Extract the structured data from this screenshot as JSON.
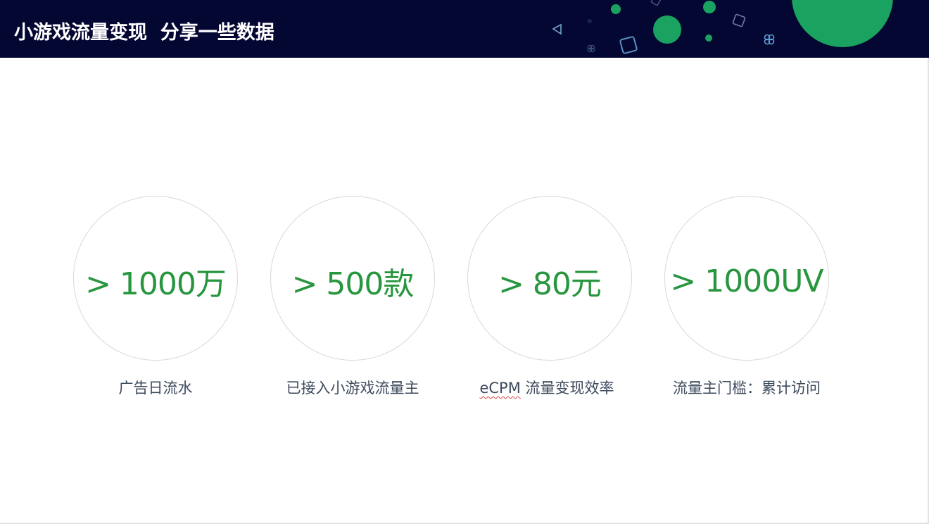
{
  "header": {
    "title": "小游戏流量变现  分享一些数据"
  },
  "stats": [
    {
      "value": "> 1000万",
      "label": "广告日流水"
    },
    {
      "value": "> 500款",
      "label": "已接入小游戏流量主"
    },
    {
      "value": "> 80元",
      "label_prefix": "eCPM",
      "label_suffix": " 流量变现效率"
    },
    {
      "value": "> 1000UV",
      "label": "流量主门槛：累计访问"
    }
  ],
  "colors": {
    "header_bg": "#050733",
    "accent_green": "#27963f",
    "deco_green": "#1aa260",
    "label_gray": "#3d4a5c",
    "circle_border": "#d8d8d8"
  },
  "icons": [
    "triangle-outline-icon",
    "square-outline-icon",
    "clover-outline-icon",
    "circle-dot-icon"
  ]
}
